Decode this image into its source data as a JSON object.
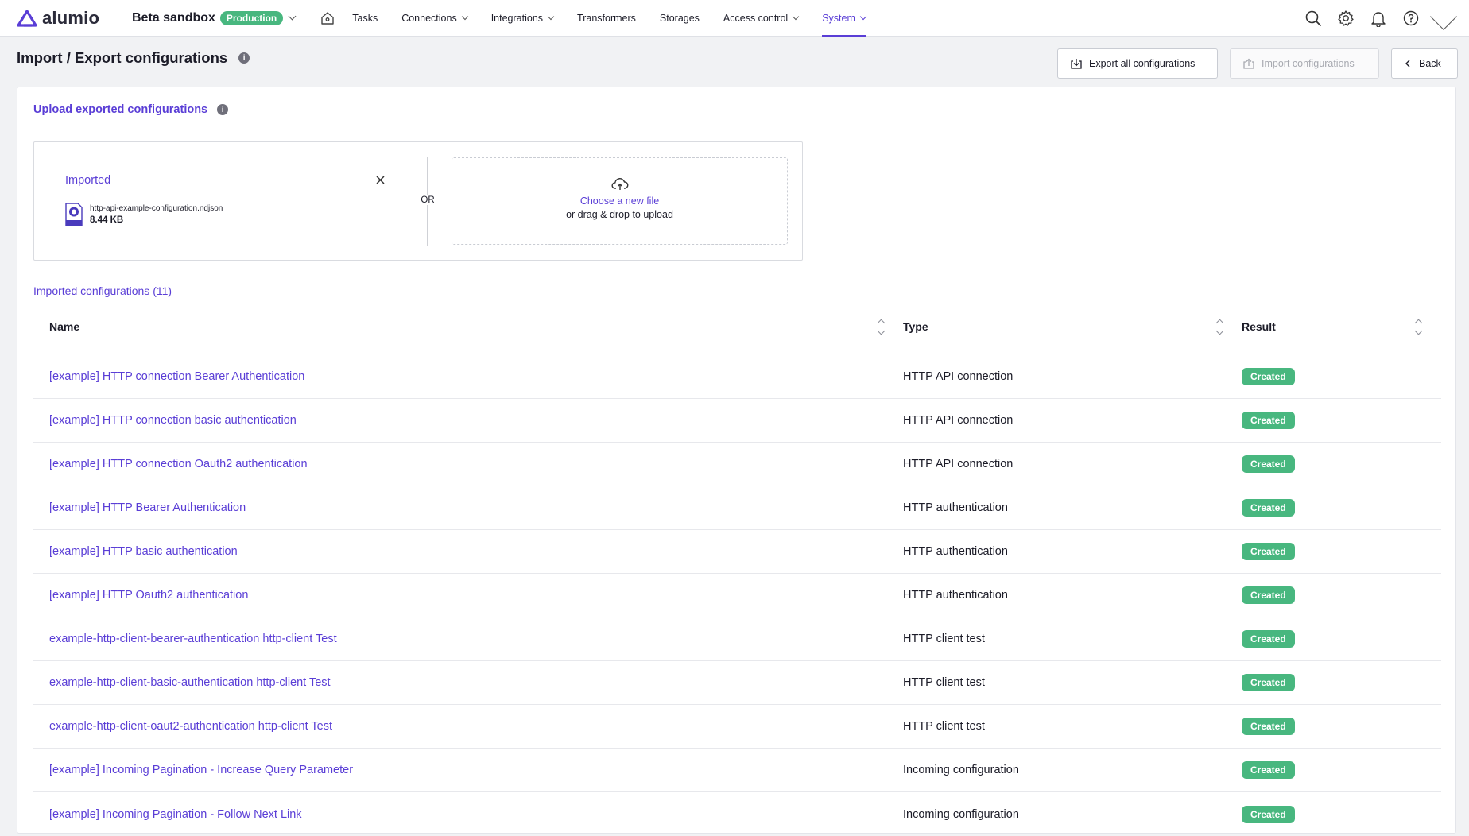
{
  "brand": {
    "name": "alumio"
  },
  "environment": {
    "name": "Beta sandbox",
    "badge": "Production"
  },
  "nav": {
    "items": [
      {
        "label": "Tasks"
      },
      {
        "label": "Connections"
      },
      {
        "label": "Integrations"
      },
      {
        "label": "Transformers"
      },
      {
        "label": "Storages"
      },
      {
        "label": "Access control"
      },
      {
        "label": "System"
      }
    ],
    "active": "System"
  },
  "page": {
    "title": "Import / Export configurations",
    "actions": {
      "export_label": "Export all configurations",
      "import_label": "Import configurations",
      "back_label": "Back"
    }
  },
  "upload": {
    "title": "Upload exported configurations",
    "status_label": "Imported",
    "file_name": "http-api-example-configuration.ndjson",
    "file_size": "8.44 KB",
    "or_label": "OR",
    "choose_label": "Choose a new file",
    "drag_label": "or drag & drop to upload"
  },
  "imported": {
    "title": "Imported configurations (11)",
    "columns": {
      "name": "Name",
      "type": "Type",
      "result": "Result"
    },
    "rows": [
      {
        "name": "[example] HTTP connection Bearer Authentication",
        "type": "HTTP API connection",
        "result": "Created"
      },
      {
        "name": "[example] HTTP connection basic authentication",
        "type": "HTTP API connection",
        "result": "Created"
      },
      {
        "name": "[example] HTTP connection Oauth2 authentication",
        "type": "HTTP API connection",
        "result": "Created"
      },
      {
        "name": "[example] HTTP Bearer Authentication",
        "type": "HTTP authentication",
        "result": "Created"
      },
      {
        "name": "[example] HTTP basic authentication",
        "type": "HTTP authentication",
        "result": "Created"
      },
      {
        "name": "[example] HTTP Oauth2 authentication",
        "type": "HTTP authentication",
        "result": "Created"
      },
      {
        "name": "example-http-client-bearer-authentication http-client Test",
        "type": "HTTP client test",
        "result": "Created"
      },
      {
        "name": "example-http-client-basic-authentication http-client Test",
        "type": "HTTP client test",
        "result": "Created"
      },
      {
        "name": "example-http-client-oaut2-authentication http-client Test",
        "type": "HTTP client test",
        "result": "Created"
      },
      {
        "name": "[example] Incoming Pagination - Increase Query Parameter",
        "type": "Incoming configuration",
        "result": "Created"
      },
      {
        "name": "[example] Incoming Pagination - Follow Next Link",
        "type": "Incoming configuration",
        "result": "Created"
      }
    ]
  },
  "colors": {
    "accent": "#5a3ed6",
    "success": "#48b77f"
  }
}
